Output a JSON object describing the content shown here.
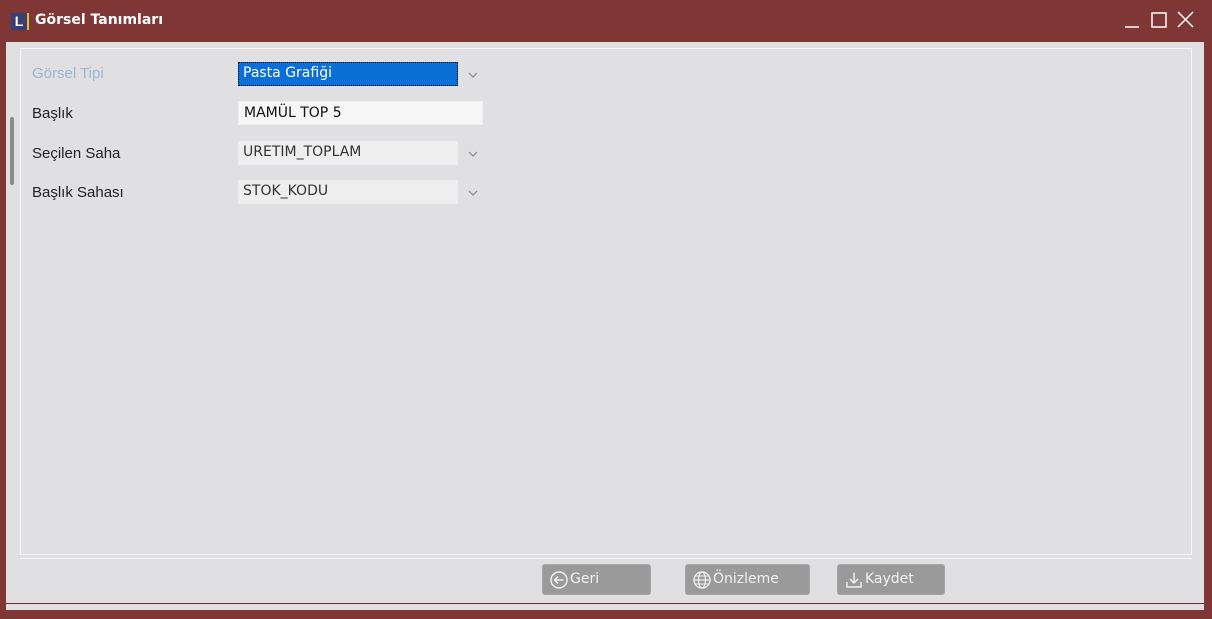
{
  "window": {
    "title": "Görsel Tanımları",
    "logo_letter": "L",
    "controls": [
      "minimize",
      "maximize",
      "close"
    ]
  },
  "form": {
    "gorsel_tipi": {
      "label": "Görsel Tipi",
      "value": "Pasta Grafiği",
      "enabled": false
    },
    "baslik": {
      "label": "Başlık",
      "value": "MAMÜL TOP 5"
    },
    "secilen_saha": {
      "label": "Seçilen Saha",
      "value": "URETIM_TOPLAM"
    },
    "baslik_sahasi": {
      "label": "Başlık Sahası",
      "value": "STOK_KODU"
    }
  },
  "buttons": {
    "geri": "Geri",
    "onizleme": "Önizleme",
    "kaydet": "Kaydet"
  },
  "icons": {
    "back": "arrow-left-circle-icon",
    "preview": "globe-icon",
    "save": "download-icon",
    "dropdown": "chevron-down-icon"
  },
  "colors": {
    "titlebar": "#7f3735",
    "window_bg": "#e0dfe1",
    "selection": "#0a6fd6",
    "button_bg": "#9a9a9a",
    "disabled_label": "#9bb6d2"
  }
}
